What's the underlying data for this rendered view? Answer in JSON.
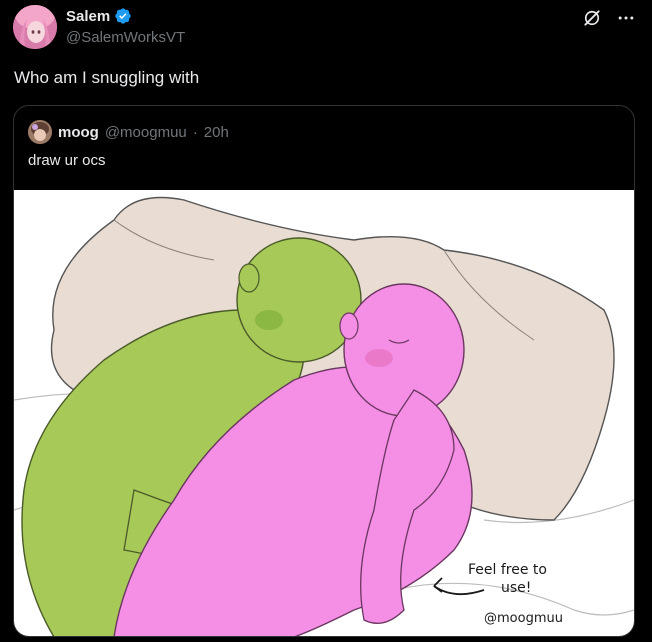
{
  "author": {
    "display_name": "Salem",
    "handle": "@SalemWorksVT",
    "verified": true
  },
  "tweet": {
    "text": "Who am I snuggling with"
  },
  "quoted": {
    "display_name": "moog",
    "handle": "@moogmuu",
    "separator": "·",
    "time": "20h",
    "text": "draw ur ocs"
  },
  "media": {
    "note_line1": "Feel free to",
    "note_line2": "use!",
    "signature": "@moogmuu"
  },
  "colors": {
    "background": "#000000",
    "text_primary": "#e7e9ea",
    "text_secondary": "#71767b",
    "border": "#2f3336",
    "verified_blue": "#1d9bf0",
    "green_figure": "#a7c957",
    "pink_figure": "#f58fe6",
    "pillow": "#e9dcd2"
  },
  "icons": {
    "verified": "verified-badge-icon",
    "grok": "grok-icon",
    "more": "more-icon"
  }
}
